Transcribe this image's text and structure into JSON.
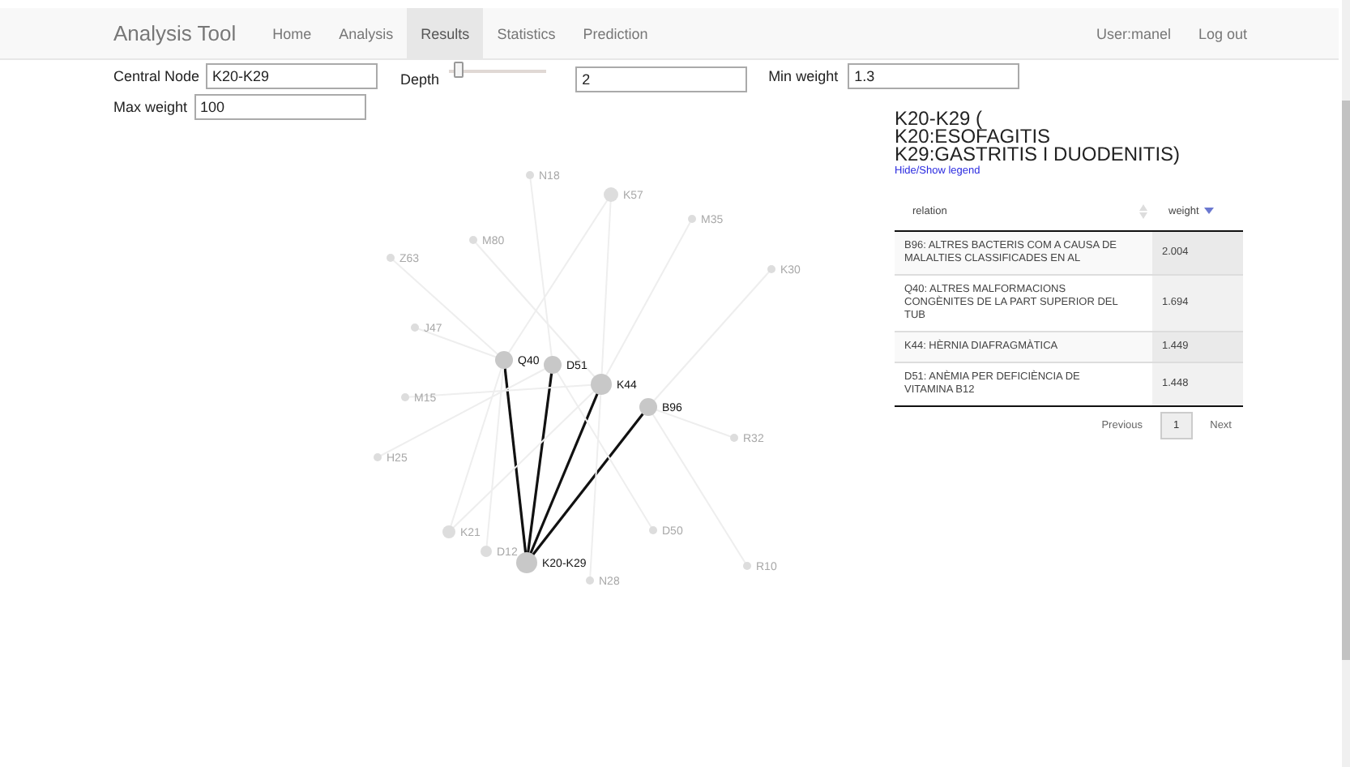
{
  "navbar": {
    "brand": "Analysis Tool",
    "links": [
      {
        "label": "Home",
        "selected": false
      },
      {
        "label": "Analysis",
        "selected": false
      },
      {
        "label": "Results",
        "selected": true
      },
      {
        "label": "Statistics",
        "selected": false
      },
      {
        "label": "Prediction",
        "selected": false
      }
    ],
    "user": "User:manel",
    "logout": "Log out"
  },
  "form": {
    "central_node": {
      "label": "Central Node",
      "value": "K20-K29"
    },
    "depth": {
      "label": "Depth",
      "level": 0.05,
      "value": "2"
    },
    "min_weight": {
      "label": "Min weight",
      "value": "1.3"
    },
    "max_weight": {
      "label": "Max weight",
      "value": "100"
    }
  },
  "graph": {
    "nodes": [
      {
        "label": "N18",
        "active": false
      },
      {
        "label": "K57",
        "active": false
      },
      {
        "label": "M35",
        "active": false
      },
      {
        "label": "M80",
        "active": false
      },
      {
        "label": "Z63",
        "active": false
      },
      {
        "label": "K30",
        "active": false
      },
      {
        "label": "J47",
        "active": false
      },
      {
        "label": "Q40",
        "active": true
      },
      {
        "label": "D51",
        "active": true
      },
      {
        "label": "K44",
        "active": true
      },
      {
        "label": "M15",
        "active": false
      },
      {
        "label": "B96",
        "active": true
      },
      {
        "label": "H25",
        "active": false
      },
      {
        "label": "R32",
        "active": false
      },
      {
        "label": "K21",
        "active": false
      },
      {
        "label": "D12",
        "active": false
      },
      {
        "label": "K20-K29",
        "active": true
      },
      {
        "label": "D50",
        "active": false
      },
      {
        "label": "R10",
        "active": false
      },
      {
        "label": "N28",
        "active": false
      }
    ]
  },
  "legend": {
    "title_lines": [
      "K20-K29 (",
      "K20:ESOFAGITIS",
      "K29:GASTRITIS I DUODENITIS)"
    ],
    "toggle": "Hide/Show legend",
    "table": {
      "columns": [
        "relation",
        "weight"
      ],
      "rows": [
        {
          "relation": "B96: ALTRES BACTERIS COM A CAUSA DE MALALTIES CLASSIFICADES EN AL",
          "weight": "2.004"
        },
        {
          "relation": "Q40: ALTRES MALFORMACIONS CONGÈNITES DE LA PART SUPERIOR DEL TUB",
          "weight": "1.694"
        },
        {
          "relation": "K44: HÈRNIA DIAFRAGMÀTICA",
          "weight": "1.449"
        },
        {
          "relation": "D51: ANÈMIA PER DEFICIÈNCIA DE VITAMINA B12",
          "weight": "1.448"
        }
      ]
    },
    "pagination": {
      "previous": "Previous",
      "page": "1",
      "next": "Next"
    }
  }
}
